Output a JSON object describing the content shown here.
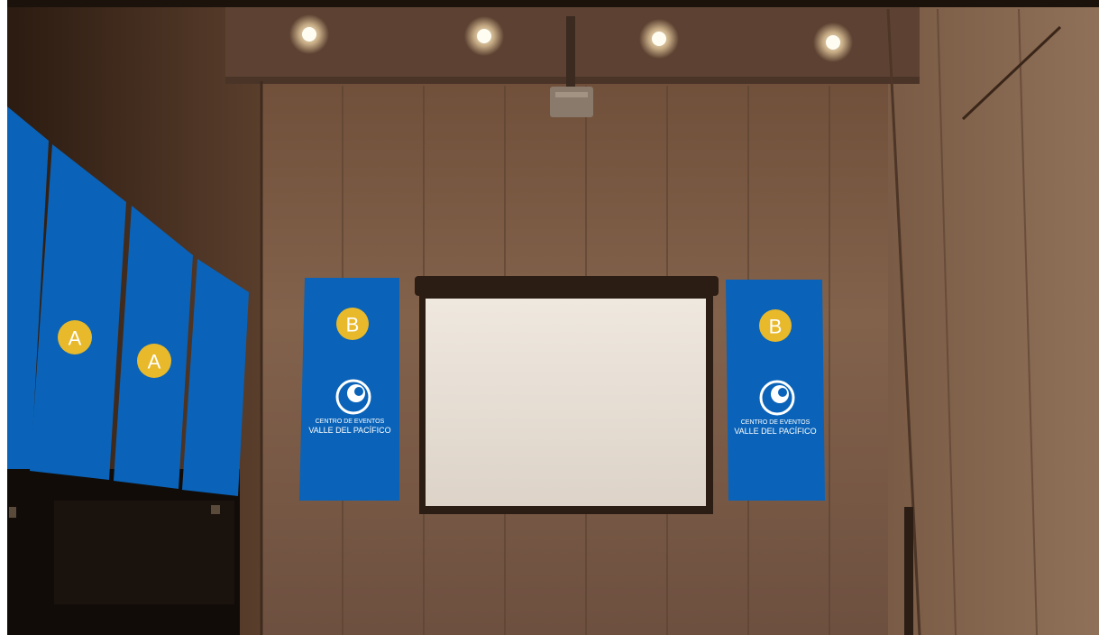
{
  "scene": {
    "colors": {
      "wall": "#7a5a44",
      "wall_dark": "#4a3325",
      "banner_blue": "#0a63b8",
      "badge_yellow": "#e8b92a",
      "screen": "#e8e2da"
    },
    "panels_a": [
      {
        "label": "A"
      },
      {
        "label": "A"
      }
    ],
    "banners_b": [
      {
        "label": "B",
        "logo_line1": "CENTRO DE EVENTOS",
        "logo_line2": "VALLE DEL PACÍFICO"
      },
      {
        "label": "B",
        "logo_line1": "CENTRO DE EVENTOS",
        "logo_line2": "VALLE DEL PACÍFICO"
      }
    ]
  }
}
